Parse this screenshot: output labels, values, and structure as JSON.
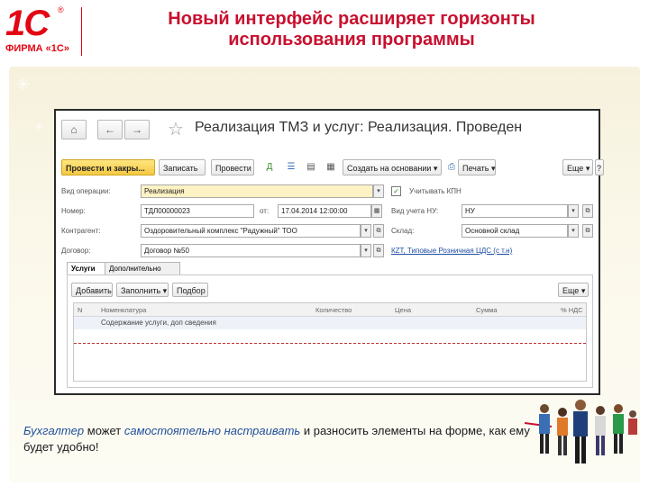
{
  "brand": {
    "logo_mark": "1C",
    "logo_reg": "®",
    "logo_sub": "ФИРМА «1С»",
    "accent_color": "#e30613"
  },
  "slide": {
    "title_line1": "Новый интерфейс расширяет горизонты",
    "title_line2": "использования программы",
    "title_color": "#c8102e"
  },
  "window": {
    "nav": {
      "home": "⌂",
      "back": "←",
      "forward": "→",
      "favorite": "☆"
    },
    "title": "Реализация ТМЗ и услуг: Реализация. Проведен",
    "toolbar": {
      "post_close": "Провести и закры...",
      "save": "Записать",
      "post": "Провести",
      "create_based_on": "Создать на основании ▾",
      "print": "Печать ▾",
      "more": "Еще ▾",
      "help": "?"
    },
    "fields": {
      "operation_type_label": "Вид операции:",
      "operation_type_value": "Реализация",
      "vat_checkbox_label": "Учитывать КПН",
      "number_label": "Номер:",
      "number_value": "ТДЛ00000023",
      "date_label": "от:",
      "date_value": "17.04.2014 12:00:00",
      "tax_accounting_label": "Вид учета НУ:",
      "tax_accounting_value": "НУ",
      "counterparty_label": "Контрагент:",
      "counterparty_value": "Оздоровительный комплекс \"Радужный\" ТОО",
      "warehouse_label": "Склад:",
      "warehouse_value": "Основной склад",
      "contract_label": "Договор:",
      "contract_value": "Договор №50",
      "vat_link": "КZТ, Типовые Розничная ЦДС (с т.н)"
    },
    "tabs": [
      "Услуги",
      "Дополнительно"
    ],
    "services_toolbar": {
      "add": "Добавить",
      "fill": "Заполнить ▾",
      "select": "Подбор",
      "more": "Еще ▾"
    },
    "grid": {
      "columns": [
        "N",
        "Номенклатура",
        "Количество",
        "Цена",
        "Сумма",
        "% НДС"
      ],
      "row_text": "Содержание услуги, доп сведения"
    }
  },
  "caption": {
    "part1": "Бухгалтер",
    "part2": " может ",
    "part3": "самостоятельно настраивать",
    "part4": " и разносить элементы на форме, как ему будет удобно!"
  }
}
